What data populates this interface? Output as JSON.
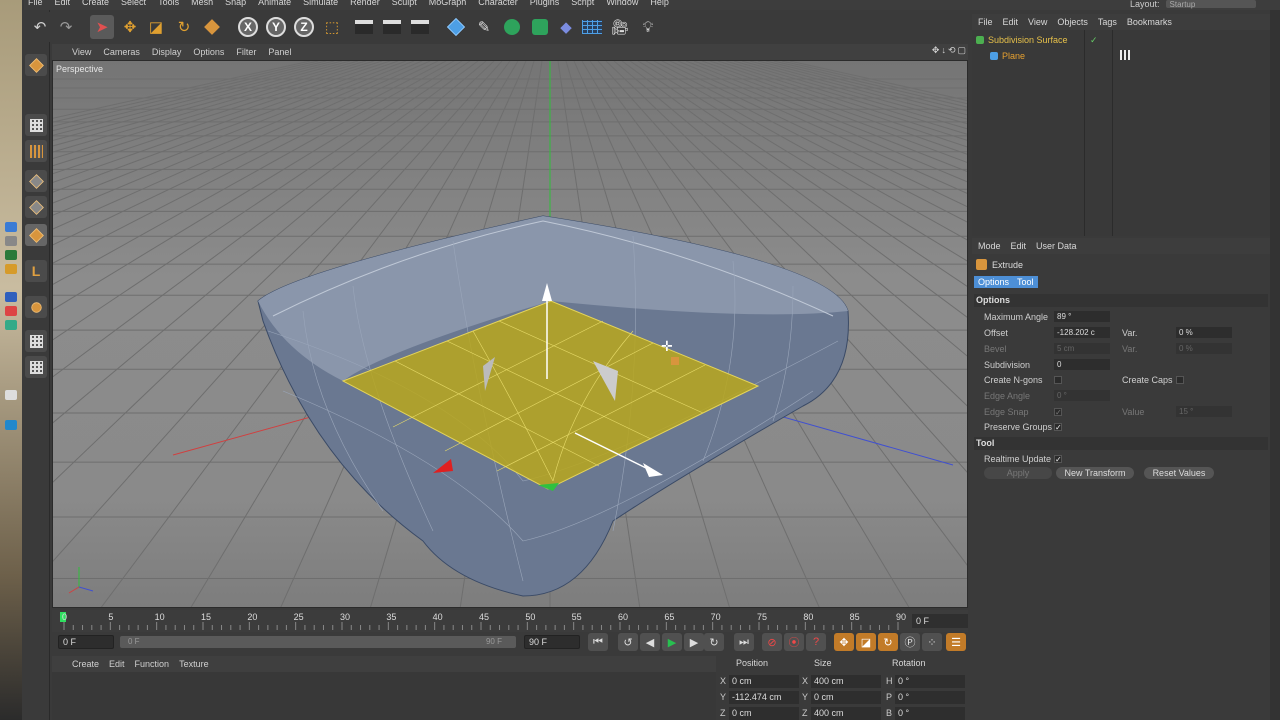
{
  "menu": [
    "File",
    "Edit",
    "Create",
    "Select",
    "Tools",
    "Mesh",
    "Snap",
    "Animate",
    "Simulate",
    "Render",
    "Sculpt",
    "MoGraph",
    "Character",
    "Plugins",
    "Script",
    "Window",
    "Help"
  ],
  "layout": {
    "label": "Layout:",
    "value": "Startup"
  },
  "viewport": {
    "menu": [
      "View",
      "Cameras",
      "Display",
      "Options",
      "Filter",
      "Panel"
    ],
    "label": "Perspective"
  },
  "timeline": {
    "ticks": [
      "0",
      "5",
      "10",
      "15",
      "20",
      "25",
      "30",
      "35",
      "40",
      "45",
      "50",
      "55",
      "60",
      "65",
      "70",
      "75",
      "80",
      "85",
      "90"
    ],
    "current_frame": "0 F"
  },
  "transport": {
    "start": "0 F",
    "slider_start": "0 F",
    "slider_end": "90 F",
    "end": "90 F"
  },
  "material": {
    "menu": [
      "Create",
      "Edit",
      "Function",
      "Texture"
    ]
  },
  "coords": {
    "headers": [
      "Position",
      "Size",
      "Rotation"
    ],
    "rows": [
      {
        "axis": "X",
        "pos": "0 cm",
        "saxis": "X",
        "size": "400 cm",
        "raxis": "H",
        "rot": "0 °"
      },
      {
        "axis": "Y",
        "pos": "-112.474 cm",
        "saxis": "Y",
        "size": "0 cm",
        "raxis": "P",
        "rot": "0 °"
      },
      {
        "axis": "Z",
        "pos": "0 cm",
        "saxis": "Z",
        "size": "400 cm",
        "raxis": "B",
        "rot": "0 °"
      }
    ]
  },
  "objects": {
    "menu": [
      "File",
      "Edit",
      "View",
      "Objects",
      "Tags",
      "Bookmarks"
    ],
    "items": [
      "Subdivision Surface",
      "Plane"
    ]
  },
  "attributes": {
    "menu": [
      "Mode",
      "Edit",
      "User Data"
    ],
    "title": "Extrude",
    "tabs": [
      "Options",
      "Tool"
    ],
    "section_options": "Options",
    "max_angle_label": "Maximum Angle",
    "max_angle": "89 °",
    "offset_label": "Offset",
    "offset": "-128.202 c",
    "var_label": "Var.",
    "var_value": "0 %",
    "bevel_label": "Bevel",
    "bevel": "5 cm",
    "var2_label": "Var.",
    "var2_value": "0 %",
    "subdivision_label": "Subdivision",
    "subdivision": "0",
    "create_ngons_label": "Create N-gons",
    "create_caps_label": "Create Caps",
    "edge_angle_label": "Edge Angle",
    "edge_angle": "0 °",
    "edge_snap_label": "Edge Snap",
    "value_label": "Value",
    "value": "15 °",
    "preserve_groups_label": "Preserve Groups",
    "section_tool": "Tool",
    "realtime_label": "Realtime Update",
    "apply": "Apply",
    "new_transform": "New Transform",
    "reset_values": "Reset Values"
  },
  "colors": {
    "accent": "#4d8fd6",
    "selection": "#c9a515",
    "orange": "#d8953d"
  }
}
